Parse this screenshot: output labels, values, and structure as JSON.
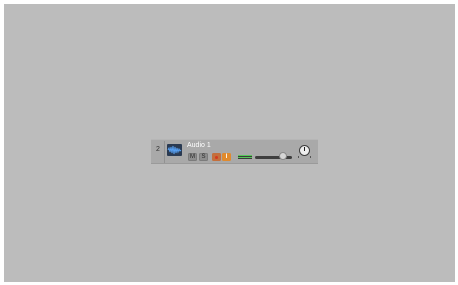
{
  "track": {
    "number": "2",
    "name": "Audio 1",
    "mute_label": "M",
    "solo_label": "S",
    "input_monitor_label": "I",
    "volume_level": 0.75,
    "pan_level": 0.5,
    "icon": "waveform-icon",
    "colors": {
      "region_bg": "#bcbcbc",
      "header_bg": "#a9a9a9",
      "record": "#c46f3c",
      "input_monitor": "#e08a2e",
      "meter": "#58c85a",
      "icon_bg": "#2a3a52",
      "waveform": "#5aa8ff"
    }
  }
}
